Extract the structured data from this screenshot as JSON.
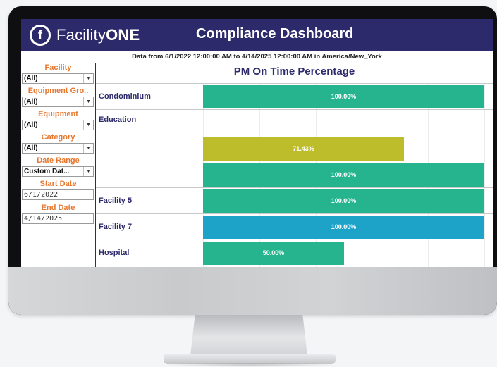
{
  "app": {
    "logo_letter": "f",
    "logo_light": "Facility",
    "logo_bold": "ONE",
    "title": "Compliance Dashboard"
  },
  "subtitle": "Data from 6/1/2022 12:00:00 AM to 4/14/2025 12:00:00 AM in America/New_York",
  "filters": {
    "facility_label": "Facility",
    "facility_value": "(All)",
    "equipment_group_label": "Equipment Gro..",
    "equipment_group_value": "(All)",
    "equipment_label": "Equipment",
    "equipment_value": "(All)",
    "category_label": "Category",
    "category_value": "(All)",
    "date_range_label": "Date Range",
    "date_range_value": "Custom Dat...",
    "start_date_label": "Start Date",
    "start_date_value": "6/1/2022",
    "end_date_label": "End Date",
    "end_date_value": "4/14/2025",
    "caret_icon": "▼"
  },
  "colors": {
    "brand": "#2d2a6c",
    "filter_label": "#e8772e",
    "bar_green": "#26b48e",
    "bar_olive": "#bdbd2c",
    "bar_blue": "#1ea3c8"
  },
  "chart_data": {
    "type": "bar",
    "orientation": "horizontal",
    "title": "PM On Time Percentage",
    "xlim": [
      0,
      100
    ],
    "groups": [
      {
        "label": "Condominium",
        "bars": [
          {
            "value": 100.0,
            "label": "100.00%",
            "color": "#26b48e"
          }
        ]
      },
      {
        "label": "Education",
        "bars": [
          {
            "value": null,
            "label": "",
            "color": ""
          },
          {
            "value": 71.43,
            "label": "71.43%",
            "color": "#bdbd2c"
          },
          {
            "value": 100.0,
            "label": "100.00%",
            "color": "#26b48e"
          }
        ]
      },
      {
        "label": "Facility 5",
        "bars": [
          {
            "value": 100.0,
            "label": "100.00%",
            "color": "#26b48e"
          }
        ]
      },
      {
        "label": "Facility 7",
        "bars": [
          {
            "value": 100.0,
            "label": "100.00%",
            "color": "#1ea3c8"
          }
        ]
      },
      {
        "label": "Hospital",
        "bars": [
          {
            "value": 50.0,
            "label": "50.00%",
            "color": "#26b48e"
          }
        ]
      }
    ]
  }
}
